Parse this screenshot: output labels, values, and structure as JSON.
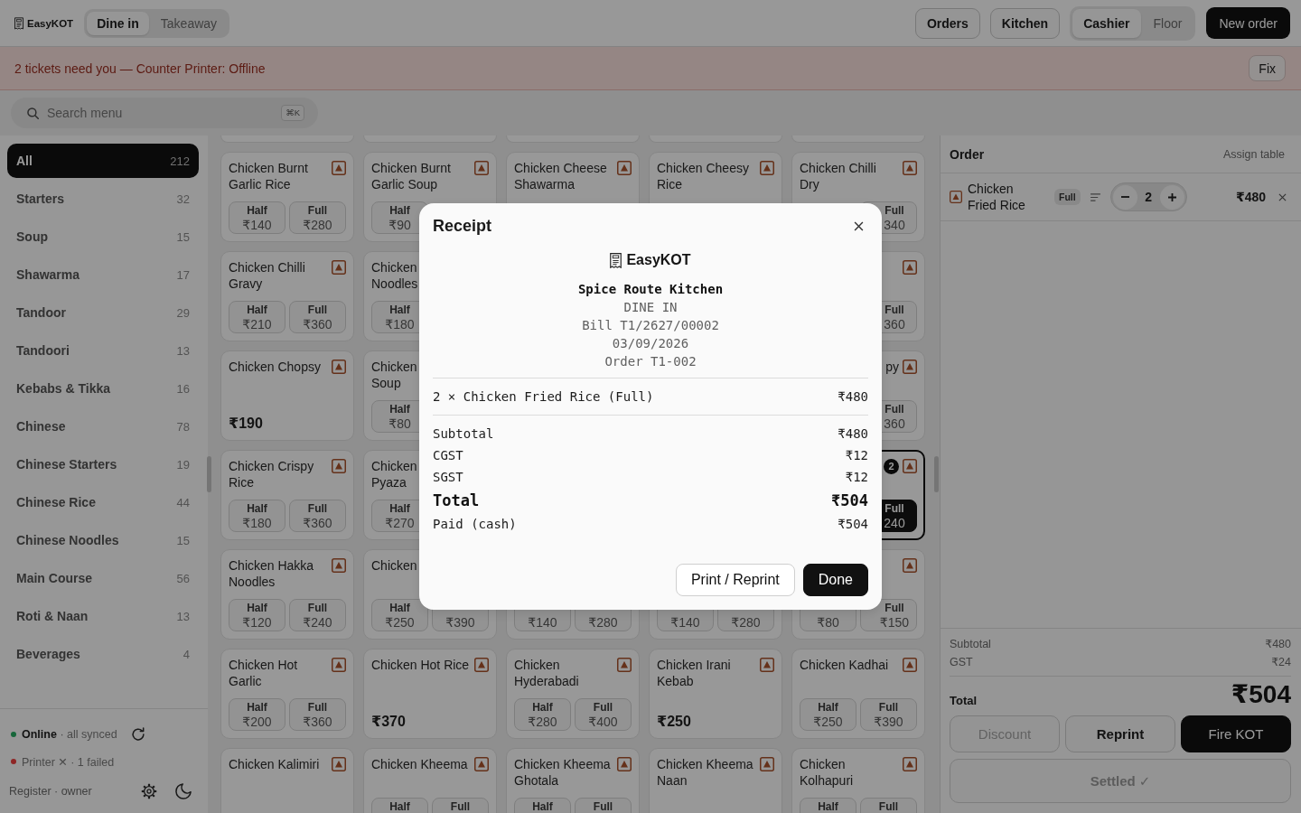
{
  "topbar": {
    "brand": "EasyKOT",
    "service_tabs": [
      {
        "label": "Dine in",
        "selected": true
      },
      {
        "label": "Takeaway",
        "selected": false
      }
    ],
    "nav_buttons": [
      "Orders",
      "Kitchen"
    ],
    "mode_tabs": [
      {
        "label": "Cashier",
        "selected": true
      },
      {
        "label": "Floor",
        "selected": false
      }
    ],
    "new_order": "New order"
  },
  "banner": {
    "message": "2 tickets need you — Counter Printer: Offline",
    "action": "Fix"
  },
  "search": {
    "placeholder": "Search menu",
    "shortcut": "⌘K"
  },
  "sidebar": {
    "categories": [
      {
        "label": "All",
        "count": "212",
        "selected": true
      },
      {
        "label": "Starters",
        "count": "32",
        "selected": false
      },
      {
        "label": "Soup",
        "count": "15",
        "selected": false
      },
      {
        "label": "Shawarma",
        "count": "17",
        "selected": false
      },
      {
        "label": "Tandoor",
        "count": "29",
        "selected": false
      },
      {
        "label": "Tandoori",
        "count": "13",
        "selected": false
      },
      {
        "label": "Kebabs & Tikka",
        "count": "16",
        "selected": false
      },
      {
        "label": "Chinese",
        "count": "78",
        "selected": false
      },
      {
        "label": "Chinese Starters",
        "count": "19",
        "selected": false
      },
      {
        "label": "Chinese Rice",
        "count": "44",
        "selected": false
      },
      {
        "label": "Chinese Noodles",
        "count": "15",
        "selected": false
      },
      {
        "label": "Main Course",
        "count": "56",
        "selected": false
      },
      {
        "label": "Roti & Naan",
        "count": "13",
        "selected": false
      },
      {
        "label": "Beverages",
        "count": "4",
        "selected": false
      }
    ],
    "statuses": [
      {
        "kind": "connection",
        "text": "**Online** · all synced",
        "color": "#17663a"
      },
      {
        "kind": "printer",
        "text": "Printer ✕ · 1 failed",
        "color": "#8e2626"
      }
    ],
    "user": "Register · owner"
  },
  "menu": {
    "rows": [
      [
        {
          "name": "Chicken Burnt Garlic Rice",
          "marker": {
            "kind": "non-veg"
          },
          "selected": false,
          "options": [
            {
              "kind": "half",
              "label": "Half",
              "price": "₹140",
              "selected": false
            },
            {
              "kind": "full",
              "label": "Full",
              "price": "₹280",
              "selected": false
            }
          ]
        },
        {
          "name": "Chicken Burnt Garlic Soup",
          "marker": {
            "kind": "non-veg"
          },
          "selected": false,
          "options": [
            {
              "kind": "half",
              "label": "Half",
              "price": "₹90",
              "selected": false
            }
          ]
        },
        {
          "name": "Chicken Cheese Shawarma",
          "marker": {
            "kind": "non-veg"
          },
          "selected": false
        },
        {
          "name": "Chicken Cheesy Rice",
          "marker": {
            "kind": "non-veg"
          },
          "selected": false
        },
        {
          "kind": "tail",
          "name": "Chicken Chilli Dry",
          "marker": {
            "kind": "non-veg"
          },
          "selected": false,
          "options": [
            {
              "kind": "full",
              "label": "Full",
              "price": "340",
              "selected": false
            }
          ]
        }
      ],
      [
        {
          "name": "Chicken Chilli Gravy",
          "marker": {
            "kind": "non-veg"
          },
          "selected": false,
          "options": [
            {
              "kind": "half",
              "label": "Half",
              "price": "₹210",
              "selected": false
            },
            {
              "kind": "full",
              "label": "Full",
              "price": "₹360",
              "selected": false
            }
          ]
        },
        {
          "kind": "head",
          "name_parts": [
            "Chicken",
            "Noodles"
          ],
          "selected": false,
          "options": [
            {
              "kind": "half",
              "label": "Half",
              "price": "₹180",
              "selected": false
            }
          ]
        },
        null,
        null,
        {
          "kind": "tail",
          "marker": {
            "kind": "non-veg"
          },
          "selected": false,
          "options": [
            {
              "kind": "full",
              "label": "Full",
              "price": "360",
              "selected": false
            }
          ]
        }
      ],
      [
        {
          "name": "Chicken Chopsy",
          "marker": {
            "kind": "non-veg"
          },
          "selected": false,
          "price": "₹190"
        },
        {
          "kind": "head",
          "name_parts": [
            "Chicken",
            "Soup"
          ],
          "selected": false,
          "options": [
            {
              "kind": "half",
              "label": "Half",
              "price": "₹80",
              "selected": false
            }
          ]
        },
        null,
        null,
        {
          "kind": "tail",
          "name_parts": [
            "py"
          ],
          "marker": {
            "kind": "non-veg"
          },
          "selected": false,
          "options": [
            {
              "kind": "full",
              "label": "Full",
              "price": "360",
              "selected": false
            }
          ]
        }
      ],
      [
        {
          "name": "Chicken Crispy Rice",
          "marker": {
            "kind": "non-veg"
          },
          "selected": false,
          "options": [
            {
              "kind": "half",
              "label": "Half",
              "price": "₹180",
              "selected": false
            },
            {
              "kind": "full",
              "label": "Full",
              "price": "₹360",
              "selected": false
            }
          ]
        },
        {
          "kind": "head",
          "name_parts": [
            "Chicken",
            "Pyaza"
          ],
          "selected": false,
          "options": [
            {
              "kind": "half",
              "label": "Half",
              "price": "₹270",
              "selected": false
            }
          ]
        },
        null,
        null,
        {
          "kind": "tail",
          "marker": {
            "kind": "non-veg"
          },
          "count": "2",
          "selected": true,
          "options": [
            {
              "kind": "full",
              "label": "Full",
              "price": "240",
              "selected": true
            }
          ]
        }
      ],
      [
        {
          "name": "Chicken Hakka Noodles",
          "marker": {
            "kind": "non-veg"
          },
          "selected": false,
          "options": [
            {
              "kind": "half",
              "label": "Half",
              "price": "₹120",
              "selected": false
            },
            {
              "kind": "full",
              "label": "Full",
              "price": "₹240",
              "selected": false
            }
          ]
        },
        {
          "kind": "head",
          "name_parts": [
            "Chicken"
          ],
          "selected": false,
          "options": [
            {
              "kind": "half",
              "label": "Half",
              "price": "₹250",
              "selected": false
            },
            {
              "kind": "full",
              "price": "₹390",
              "selected": false
            }
          ]
        },
        {
          "selected": false,
          "options": [
            {
              "kind": "half",
              "price": "₹140",
              "selected": false
            },
            {
              "kind": "full",
              "price": "₹280",
              "selected": false
            }
          ]
        },
        {
          "selected": false,
          "options": [
            {
              "kind": "half",
              "price": "₹140",
              "selected": false
            },
            {
              "kind": "full",
              "price": "₹280",
              "selected": false
            }
          ]
        },
        {
          "kind": "tail",
          "marker": {
            "kind": "non-veg"
          },
          "selected": false,
          "options": [
            {
              "kind": "half",
              "price": "₹80",
              "selected": false
            },
            {
              "kind": "full",
              "label": "Full",
              "price": "₹150",
              "selected": false
            }
          ]
        }
      ],
      [
        {
          "name": "Chicken Hot Garlic",
          "marker": {
            "kind": "non-veg"
          },
          "selected": false,
          "options": [
            {
              "kind": "half",
              "label": "Half",
              "price": "₹200",
              "selected": false
            },
            {
              "kind": "full",
              "label": "Full",
              "price": "₹360",
              "selected": false
            }
          ]
        },
        {
          "name": "Chicken Hot Rice",
          "marker": {
            "kind": "non-veg"
          },
          "selected": false,
          "price": "₹370"
        },
        {
          "name": "Chicken Hyderabadi",
          "marker": {
            "kind": "non-veg"
          },
          "selected": false,
          "options": [
            {
              "kind": "half",
              "label": "Half",
              "price": "₹280",
              "selected": false
            },
            {
              "kind": "full",
              "label": "Full",
              "price": "₹400",
              "selected": false
            }
          ]
        },
        {
          "name": "Chicken Irani Kebab",
          "marker": {
            "kind": "non-veg"
          },
          "selected": false,
          "price": "₹250"
        },
        {
          "name": "Chicken Kadhai",
          "marker": {
            "kind": "non-veg"
          },
          "selected": false,
          "options": [
            {
              "kind": "half",
              "label": "Half",
              "price": "₹250",
              "selected": false
            },
            {
              "kind": "full",
              "label": "Full",
              "price": "₹390",
              "selected": false
            }
          ]
        }
      ],
      [
        {
          "name": "Chicken Kalimiri",
          "marker": {
            "kind": "non-veg"
          },
          "selected": false
        },
        {
          "name": "Chicken Kheema",
          "marker": {
            "kind": "non-veg"
          },
          "selected": false,
          "options": [
            {
              "kind": "half",
              "label": "Half",
              "selected": false
            },
            {
              "kind": "full",
              "label": "Full",
              "selected": false
            }
          ]
        },
        {
          "name": "Chicken Kheema Ghotala",
          "marker": {
            "kind": "non-veg"
          },
          "selected": false,
          "options": [
            {
              "kind": "half",
              "label": "Half",
              "selected": false
            },
            {
              "kind": "full",
              "label": "Full",
              "selected": false
            }
          ]
        },
        {
          "name": "Chicken Kheema Naan",
          "marker": {
            "kind": "non-veg"
          },
          "selected": false
        },
        {
          "name": "Chicken Kolhapuri",
          "marker": {
            "kind": "non-veg"
          },
          "selected": false,
          "options": [
            {
              "kind": "half",
              "label": "Half",
              "selected": false
            },
            {
              "kind": "full",
              "label": "Full",
              "selected": false
            }
          ]
        }
      ]
    ]
  },
  "order": {
    "title": "Order",
    "assign": "Assign table",
    "items": [
      {
        "marker": {
          "kind": "non-veg"
        },
        "name": "Chicken Fried Rice",
        "size": "Full",
        "quantity": "2",
        "amount": "₹480"
      }
    ],
    "summary": [
      {
        "label": "Subtotal",
        "amount": "₹480"
      },
      {
        "label": "GST",
        "amount": "₹24"
      }
    ],
    "total": {
      "label": "Total",
      "amount": "₹504"
    },
    "actions": [
      {
        "label": "Discount",
        "kind": "outline",
        "disabled": true
      },
      {
        "label": "Reprint",
        "kind": "outline",
        "disabled": false
      },
      {
        "label": "Fire KOT",
        "kind": "primary",
        "disabled": false
      }
    ],
    "settle": {
      "label": "Settled ✓",
      "disabled": true
    }
  },
  "receipt": {
    "title": "Receipt",
    "brand": "EasyKOT",
    "header": [
      {
        "text": "Spice Route Kitchen",
        "kind": "title"
      },
      {
        "text": "DINE IN",
        "kind": "meta"
      },
      {
        "text": "Bill T1/2627/00002",
        "kind": "meta"
      },
      {
        "text": "03/09/2026",
        "kind": "meta"
      },
      {
        "text": "Order T1-002",
        "kind": "meta"
      }
    ],
    "items": [
      {
        "text": "2 × Chicken Fried Rice (Full)",
        "amount": "₹480"
      }
    ],
    "totals": [
      {
        "label": "Subtotal",
        "amount": "₹480",
        "kind": "line"
      },
      {
        "label": "CGST",
        "amount": "₹12",
        "kind": "line"
      },
      {
        "label": "SGST",
        "amount": "₹12",
        "kind": "line"
      },
      {
        "label": "Total",
        "amount": "₹504",
        "kind": "grand"
      },
      {
        "label": "Paid (cash)",
        "amount": "₹504",
        "kind": "line"
      }
    ],
    "buttons": [
      {
        "label": "Print / Reprint",
        "kind": "secondary"
      },
      {
        "label": "Done",
        "kind": "primary"
      }
    ]
  }
}
